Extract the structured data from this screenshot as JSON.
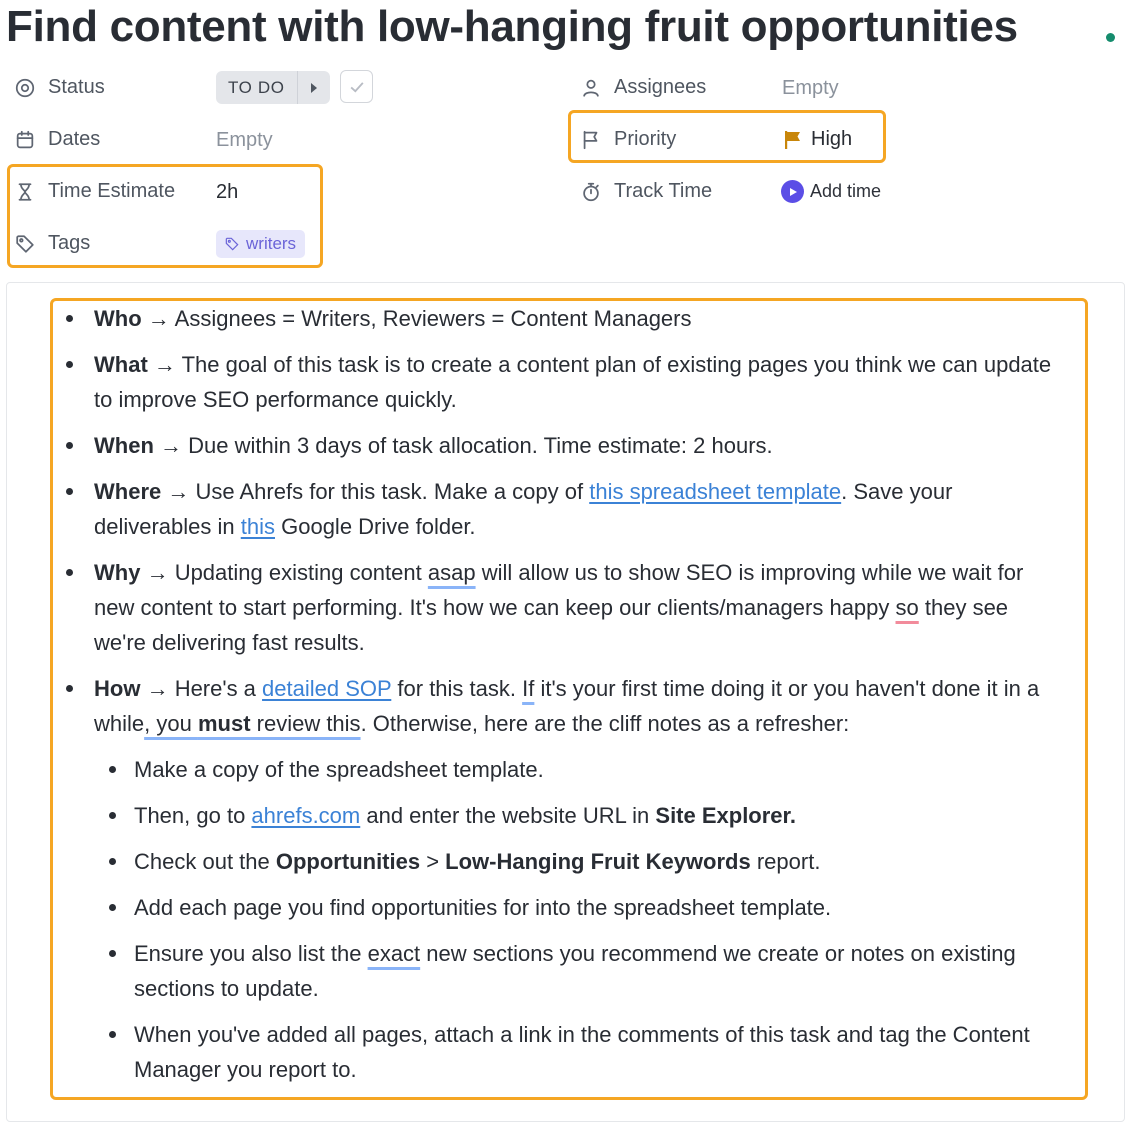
{
  "task": {
    "title": "Find content with low-hanging fruit opportunities"
  },
  "fields": {
    "status": {
      "label": "Status",
      "value": "TO DO"
    },
    "dates": {
      "label": "Dates",
      "value": "Empty"
    },
    "time_estimate": {
      "label": "Time Estimate",
      "value": "2h"
    },
    "tags": {
      "label": "Tags",
      "value": "writers"
    },
    "assignees": {
      "label": "Assignees",
      "value": "Empty"
    },
    "priority": {
      "label": "Priority",
      "value": "High",
      "flag_color": "#c8860a"
    },
    "track_time": {
      "label": "Track Time",
      "action": "Add time"
    }
  },
  "colors": {
    "highlight": "#f5a623",
    "link": "#3b82d6",
    "tag_bg": "#e7e7fb",
    "tag_text": "#6b64d8",
    "play_button": "#5b4ee6",
    "status_dot": "#158c6d"
  },
  "description": {
    "arrow": " → ",
    "who": {
      "label": "Who",
      "text": "Assignees = Writers, Reviewers = Content Managers"
    },
    "what": {
      "label": "What",
      "text": "The goal of this task is to create a content plan of existing pages you think we can update to improve SEO performance quickly."
    },
    "when": {
      "label": "When",
      "text": "Due within 3 days of task allocation. Time estimate: 2 hours."
    },
    "where": {
      "label": "Where",
      "text_1": "Use Ahrefs for this task. Make a copy of ",
      "link_1": "this spreadsheet template",
      "text_2": ". Save your deliverables in ",
      "link_2": "this",
      "text_3": " Google Drive folder."
    },
    "why": {
      "label": "Why",
      "text_1": "Updating existing content ",
      "flag_1": "asap",
      "text_2": " will allow us to show SEO is improving while we wait for new content to start performing. It's how we can keep our clients/managers happy ",
      "flag_2": "so",
      "text_3": " they see we're delivering fast results."
    },
    "how": {
      "label": "How",
      "text_1": "Here's a ",
      "link_1": "detailed SOP",
      "text_2": " for this task. ",
      "flag_1": "If",
      "text_3": " it's your first time doing it or you haven't done it in a while",
      "flag_2": ", you ",
      "bold_1": "must",
      "flag_3": " review this",
      "text_4": ". Otherwise, here are the cliff notes as a refresher:",
      "steps": {
        "s1": "Make a copy of the spreadsheet template.",
        "s2_a": "Then, go to ",
        "s2_link": "ahrefs.com",
        "s2_b": " and enter the website URL in ",
        "s2_bold": "Site Explorer.",
        "s3_a": "Check out the ",
        "s3_bold_1": "Opportunities",
        "s3_b": " > ",
        "s3_bold_2": "Low-Hanging Fruit Keywords",
        "s3_c": " report.",
        "s4": "Add each page you find opportunities for into the spreadsheet template.",
        "s5_a": "Ensure you also list the ",
        "s5_flag": "exact",
        "s5_b": " new sections you recommend we create or notes on existing sections to update.",
        "s6": "When you've added all pages, attach a link in the comments of this task and tag the Content Manager you report to."
      }
    }
  }
}
